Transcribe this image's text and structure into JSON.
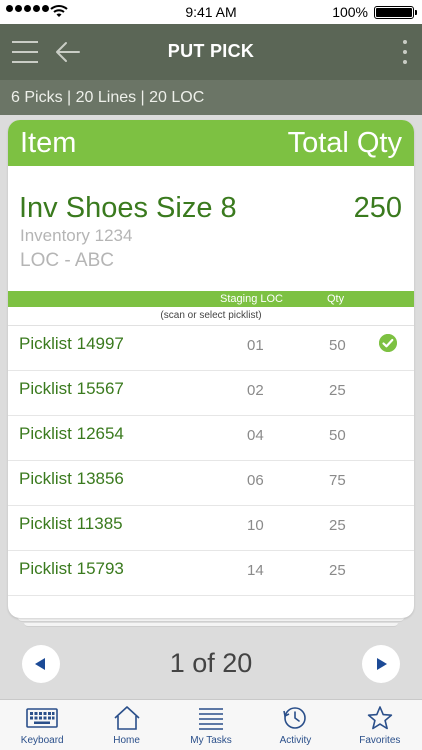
{
  "status_bar": {
    "time": "9:41 AM",
    "battery": "100%"
  },
  "nav": {
    "title": "PUT PICK"
  },
  "summary": {
    "text": "6 Picks  |  20 Lines  |  20 LOC"
  },
  "card": {
    "header_item": "Item",
    "header_qty": "Total Qty",
    "item": {
      "name": "Inv Shoes Size 8",
      "qty": "250",
      "inventory": "Inventory 1234",
      "loc": "LOC - ABC"
    },
    "list_header": {
      "staging_loc": "Staging LOC",
      "qty": "Qty"
    },
    "hint": "(scan or select picklist)",
    "rows": [
      {
        "name": "Picklist 14997",
        "loc": "01",
        "qty": "50",
        "checked": true
      },
      {
        "name": "Picklist 15567",
        "loc": "02",
        "qty": "25",
        "checked": false
      },
      {
        "name": "Picklist 12654",
        "loc": "04",
        "qty": "50",
        "checked": false
      },
      {
        "name": "Picklist 13856",
        "loc": "06",
        "qty": "75",
        "checked": false
      },
      {
        "name": "Picklist 11385",
        "loc": "10",
        "qty": "25",
        "checked": false
      },
      {
        "name": "Picklist 15793",
        "loc": "14",
        "qty": "25",
        "checked": false
      }
    ]
  },
  "pager": {
    "text": "1 of 20"
  },
  "tabs": [
    {
      "label": "Keyboard",
      "icon": "keyboard-icon"
    },
    {
      "label": "Home",
      "icon": "home-icon"
    },
    {
      "label": "My Tasks",
      "icon": "tasks-icon"
    },
    {
      "label": "Activity",
      "icon": "activity-icon"
    },
    {
      "label": "Favorites",
      "icon": "star-icon"
    }
  ],
  "colors": {
    "accent_green": "#7dc142",
    "nav_bg": "#5b6656",
    "text_green": "#3a7a1e",
    "tab_blue": "#2a4f8a"
  }
}
